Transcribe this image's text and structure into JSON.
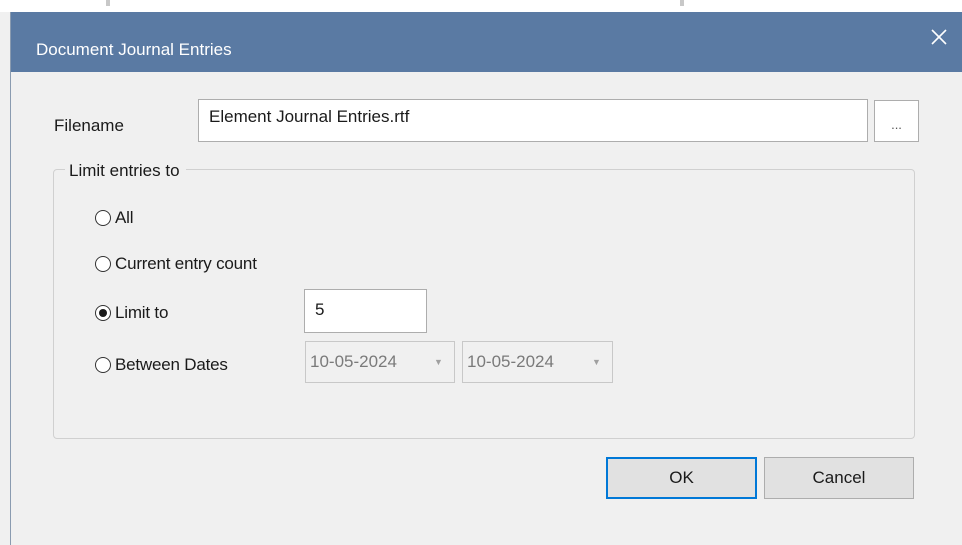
{
  "dialog": {
    "title": "Document Journal Entries"
  },
  "filename": {
    "label": "Filename",
    "value": "Element Journal Entries.rtf",
    "browse_label": "..."
  },
  "limit_group": {
    "legend": "Limit entries to",
    "options": {
      "all": "All",
      "current": "Current entry count",
      "limit_to": "Limit to",
      "between": "Between Dates"
    },
    "selected": "limit_to",
    "limit_value": "5",
    "date_from": "10-05-2024",
    "date_to": "10-05-2024",
    "date_dropdown_glyph": "▼"
  },
  "buttons": {
    "ok": "OK",
    "cancel": "Cancel"
  },
  "icons": {
    "close": "close-icon",
    "radio": "radio-icon",
    "dropdown": "chevron-down-icon"
  },
  "colors": {
    "titlebar": "#5a7aa3",
    "window_bg": "#f0f0f0",
    "default_button_border": "#0078d7"
  }
}
